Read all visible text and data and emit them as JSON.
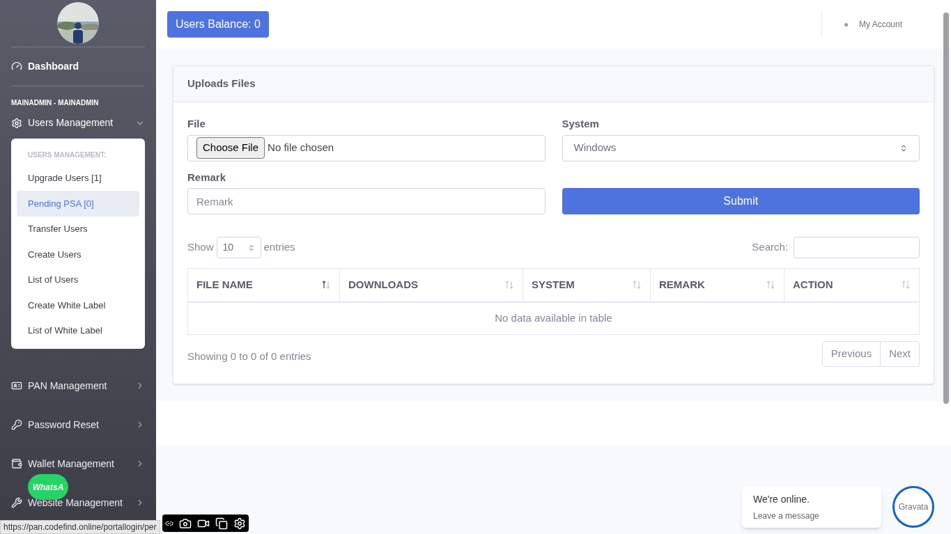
{
  "sidebar": {
    "dashboard": "Dashboard",
    "heading": "MAINADMIN - MAINADMIN",
    "sections": [
      {
        "label": "Users Management",
        "expanded": true,
        "submenu": {
          "heading": "USERS MANAGEMENT:",
          "items": [
            {
              "label": "Upgrade Users [1]",
              "selected": false
            },
            {
              "label": "Pending PSA [0]",
              "selected": true
            },
            {
              "label": "Transfer Users",
              "selected": false
            },
            {
              "label": "Create Users",
              "selected": false
            },
            {
              "label": "List of Users",
              "selected": false
            },
            {
              "label": "Create White Label",
              "selected": false
            },
            {
              "label": "List of White Label",
              "selected": false
            }
          ]
        }
      },
      {
        "label": "PAN Management",
        "expanded": false
      },
      {
        "label": "Password Reset",
        "expanded": false
      },
      {
        "label": "Wallet Management",
        "expanded": false
      },
      {
        "label": "Website Management",
        "expanded": false
      }
    ]
  },
  "topbar": {
    "balance": "Users Balance: 0",
    "account": "My Account"
  },
  "card": {
    "title": "Uploads Files",
    "file": {
      "label": "File",
      "button": "Choose File",
      "status": "No file chosen"
    },
    "system": {
      "label": "System",
      "value": "Windows"
    },
    "remark": {
      "label": "Remark",
      "placeholder": "Remark"
    },
    "submit": "Submit",
    "length": {
      "before": "Show",
      "value": "10",
      "after": "entries"
    },
    "search": {
      "label": "Search:"
    },
    "columns": [
      {
        "label": "FILE NAME",
        "sorted": true
      },
      {
        "label": "DOWNLOADS",
        "sorted": false
      },
      {
        "label": "SYSTEM",
        "sorted": false
      },
      {
        "label": "REMARK",
        "sorted": false
      },
      {
        "label": "ACTION",
        "sorted": false
      }
    ],
    "empty": "No data available in table",
    "info": "Showing 0 to 0 of 0 entries",
    "pages": [
      "Previous",
      "Next"
    ]
  },
  "whatsapp": "WhatsA",
  "chat": {
    "title": "We're online.",
    "subtitle": "Leave a message",
    "avatar": "Gravata"
  },
  "status_url": "https://pan.codefind.online/portallogin/per"
}
